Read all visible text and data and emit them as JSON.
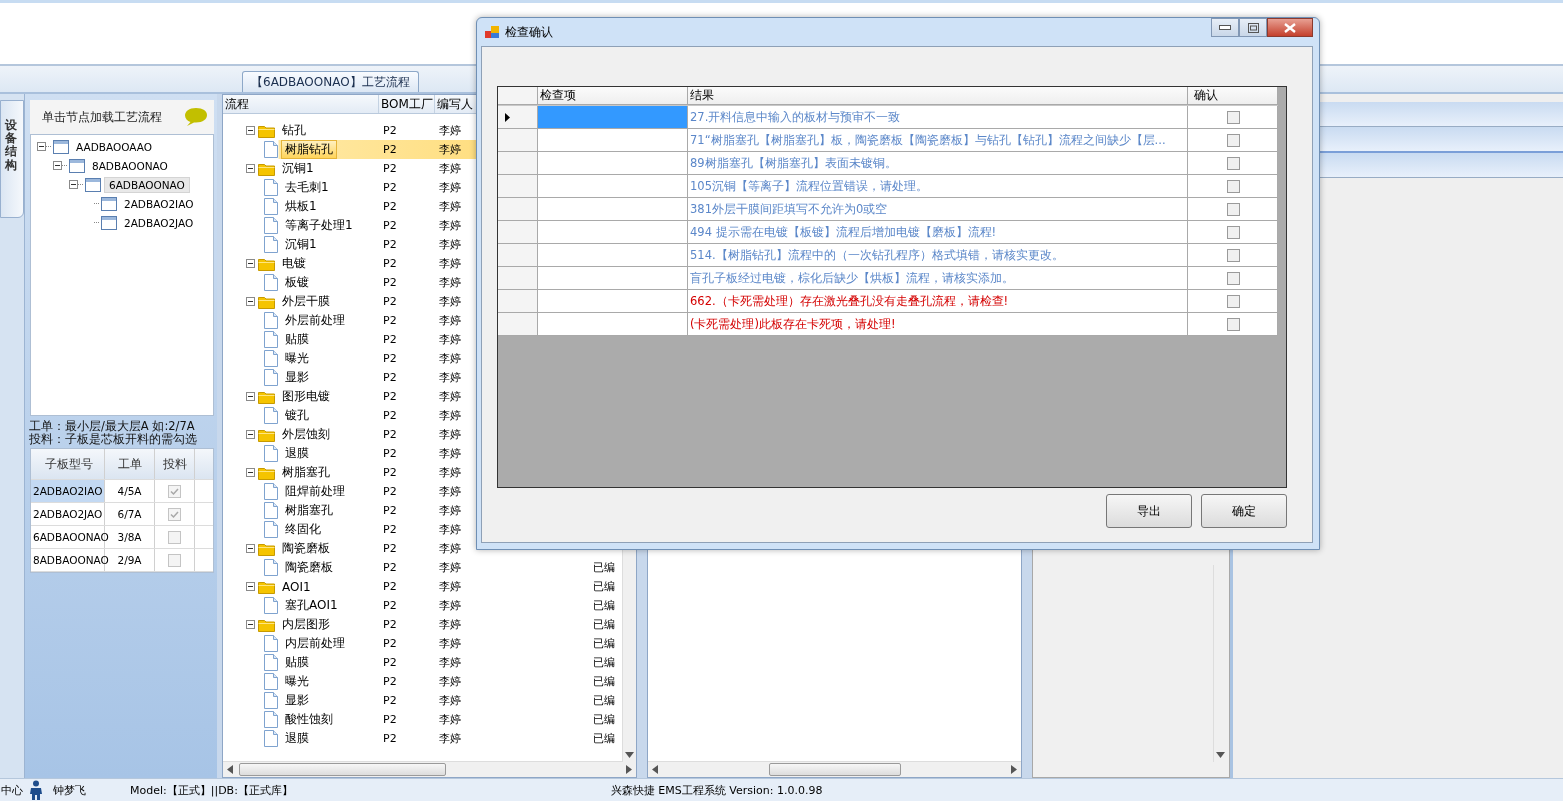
{
  "process_tab": {
    "label": "【6ADBAOONAO】工艺流程",
    "selected": true
  },
  "side_tab": {
    "label": "设备结构",
    "selected": true
  },
  "structure": {
    "hint": "单击节点加载工艺流程",
    "tree": [
      {
        "label": "AADBAOOAAO",
        "expanded": true,
        "selected": false,
        "children": [
          {
            "label": "8ADBAOONAO",
            "expanded": true,
            "selected": false,
            "children": [
              {
                "label": "6ADBAOONAO",
                "expanded": true,
                "selected": true,
                "children": [
                  {
                    "label": "2ADBAO2IAO",
                    "selected": false
                  },
                  {
                    "label": "2ADBAO2JAO",
                    "selected": false
                  }
                ]
              }
            ]
          }
        ]
      }
    ],
    "notes": [
      "工单：最小层/最大层A 如:2/7A",
      "投料：子板是芯板开料的需勾选"
    ],
    "table": {
      "columns": [
        "子板型号",
        "工单",
        "投料"
      ],
      "rows": [
        {
          "model": "2ADBAO2IAO",
          "order": "4/5A",
          "checked": true,
          "selected": true
        },
        {
          "model": "2ADBAO2JAO",
          "order": "6/7A",
          "checked": true,
          "selected": false
        },
        {
          "model": "6ADBAOONAO",
          "order": "3/8A",
          "checked": false,
          "selected": false
        },
        {
          "model": "8ADBAOONAO",
          "order": "2/9A",
          "checked": false,
          "selected": false
        }
      ]
    }
  },
  "flow": {
    "columns": [
      "流程",
      "BOM工厂",
      "编写人"
    ],
    "rows": [
      {
        "name": "钻孔",
        "factory": "P2",
        "author": "李婷",
        "expanded": true,
        "selected": false,
        "children": [
          {
            "name": "树脂钻孔",
            "factory": "P2",
            "author": "李婷",
            "selected": true
          }
        ]
      },
      {
        "name": "沉铜1",
        "factory": "P2",
        "author": "李婷",
        "expanded": true,
        "selected": false,
        "children": [
          {
            "name": "去毛刺1",
            "factory": "P2",
            "author": "李婷",
            "selected": false
          },
          {
            "name": "烘板1",
            "factory": "P2",
            "author": "李婷",
            "selected": false
          },
          {
            "name": "等离子处理1",
            "factory": "P2",
            "author": "李婷",
            "selected": false
          },
          {
            "name": "沉铜1",
            "factory": "P2",
            "author": "李婷",
            "selected": false
          }
        ]
      },
      {
        "name": "电镀",
        "factory": "P2",
        "author": "李婷",
        "expanded": true,
        "selected": false,
        "children": [
          {
            "name": "板镀",
            "factory": "P2",
            "author": "李婷",
            "selected": false
          }
        ]
      },
      {
        "name": "外层干膜",
        "factory": "P2",
        "author": "李婷",
        "expanded": true,
        "selected": false,
        "children": [
          {
            "name": "外层前处理",
            "factory": "P2",
            "author": "李婷",
            "selected": false
          },
          {
            "name": "贴膜",
            "factory": "P2",
            "author": "李婷",
            "selected": false
          },
          {
            "name": "曝光",
            "factory": "P2",
            "author": "李婷",
            "selected": false
          },
          {
            "name": "显影",
            "factory": "P2",
            "author": "李婷",
            "selected": false
          }
        ]
      },
      {
        "name": "图形电镀",
        "factory": "P2",
        "author": "李婷",
        "expanded": true,
        "selected": false,
        "children": [
          {
            "name": "镀孔",
            "factory": "P2",
            "author": "李婷",
            "selected": false
          }
        ]
      },
      {
        "name": "外层蚀刻",
        "factory": "P2",
        "author": "李婷",
        "expanded": true,
        "selected": false,
        "children": [
          {
            "name": "退膜",
            "factory": "P2",
            "author": "李婷",
            "selected": false
          }
        ]
      },
      {
        "name": "树脂塞孔",
        "factory": "P2",
        "author": "李婷",
        "expanded": true,
        "selected": false,
        "children": [
          {
            "name": "阻焊前处理",
            "factory": "P2",
            "author": "李婷",
            "selected": false
          },
          {
            "name": "树脂塞孔",
            "factory": "P2",
            "author": "李婷",
            "selected": false
          },
          {
            "name": "终固化",
            "factory": "P2",
            "author": "李婷",
            "selected": false
          }
        ]
      },
      {
        "name": "陶瓷磨板",
        "factory": "P2",
        "author": "李婷",
        "expanded": true,
        "selected": false,
        "children": [
          {
            "name": "陶瓷磨板",
            "factory": "P2",
            "author": "李婷",
            "status": "已编",
            "selected": false
          }
        ]
      },
      {
        "name": "AOI1",
        "factory": "P2",
        "author": "李婷",
        "status": "已编",
        "expanded": true,
        "selected": false,
        "children": [
          {
            "name": "塞孔AOI1",
            "factory": "P2",
            "author": "李婷",
            "status": "已编",
            "selected": false
          }
        ]
      },
      {
        "name": "内层图形",
        "factory": "P2",
        "author": "李婷",
        "status": "已编",
        "expanded": true,
        "selected": false,
        "children": [
          {
            "name": "内层前处理",
            "factory": "P2",
            "author": "李婷",
            "status": "已编",
            "selected": false
          },
          {
            "name": "贴膜",
            "factory": "P2",
            "author": "李婷",
            "status": "已编",
            "selected": false
          },
          {
            "name": "曝光",
            "factory": "P2",
            "author": "李婷",
            "status": "已编",
            "selected": false
          },
          {
            "name": "显影",
            "factory": "P2",
            "author": "李婷",
            "status": "已编",
            "selected": false
          },
          {
            "name": "酸性蚀刻",
            "factory": "P2",
            "author": "李婷",
            "status": "已编",
            "selected": false
          },
          {
            "name": "退膜",
            "factory": "P2",
            "author": "李婷",
            "status": "已编",
            "selected": false
          }
        ]
      }
    ]
  },
  "dialog": {
    "title": "检查确认",
    "columns": [
      "检查项",
      "结果",
      "确认"
    ],
    "rows": [
      {
        "result": "27.开料信息中输入的板材与预审不一致",
        "color": "#5b87c9",
        "checked": false,
        "selected": true
      },
      {
        "result": "71“树脂塞孔【树脂塞孔】板，陶瓷磨板【陶瓷磨板】与钻孔【钻孔】流程之间缺少【层...",
        "color": "#5b87c9",
        "checked": false,
        "selected": false
      },
      {
        "result": "89树脂塞孔【树脂塞孔】表面未镀铜。",
        "color": "#5b87c9",
        "checked": false,
        "selected": false
      },
      {
        "result": "105沉铜【等离子】流程位置错误，请处理。",
        "color": "#5b87c9",
        "checked": false,
        "selected": false
      },
      {
        "result": "381外层干膜间距填写不允许为0或空",
        "color": "#5b87c9",
        "checked": false,
        "selected": false
      },
      {
        "result": "494 提示需在电镀【板镀】流程后增加电镀【磨板】流程!",
        "color": "#5b87c9",
        "checked": false,
        "selected": false
      },
      {
        "result": "514.【树脂钻孔】流程中的（一次钻孔程序）格式填错，请核实更改。",
        "color": "#5b87c9",
        "checked": false,
        "selected": false
      },
      {
        "result": "盲孔子板经过电镀，棕化后缺少【烘板】流程，请核实添加。",
        "color": "#5b87c9",
        "checked": false,
        "selected": false
      },
      {
        "result": "662.（卡死需处理）存在激光叠孔没有走叠孔流程，请检查!",
        "color": "#d40000",
        "checked": false,
        "selected": false
      },
      {
        "result": "(卡死需处理)此板存在卡死项，请处理!",
        "color": "#d40000",
        "checked": false,
        "selected": false
      }
    ],
    "buttons": [
      "导出",
      "确定"
    ]
  },
  "status_bar": {
    "place": "中心",
    "user": "钟梦飞",
    "db": "Model:【正式】||DB:【正式库】",
    "app": "兴森快捷 EMS工程系统 Version: 1.0.0.98"
  }
}
